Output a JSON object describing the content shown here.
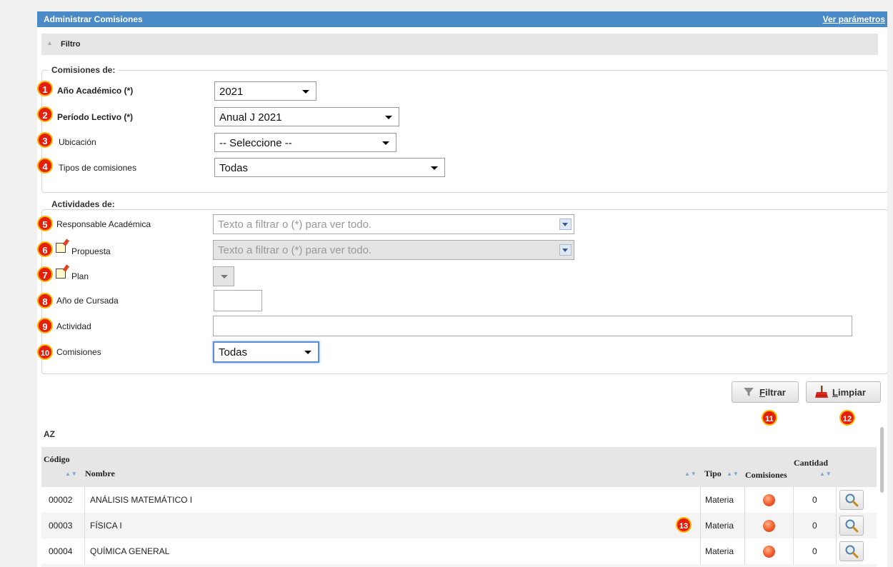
{
  "header": {
    "title": "Administrar Comisiones",
    "link": "Ver parámetros"
  },
  "filter": {
    "title": "Filtro"
  },
  "comisiones_group": {
    "legend": "Comisiones de:",
    "fields": [
      {
        "badge": "1",
        "label": "Año Académico (*)",
        "value": "2021"
      },
      {
        "badge": "2",
        "label": "Período Lectivo (*)",
        "value": "Anual J 2021"
      },
      {
        "badge": "3",
        "label": "Ubicación",
        "value": "-- Seleccione --"
      },
      {
        "badge": "4",
        "label": "Tipos de comisiones",
        "value": "Todas"
      }
    ]
  },
  "actividades_group": {
    "legend": "Actividades de:",
    "fields": [
      {
        "badge": "5",
        "label": "Responsable Académica",
        "placeholder": "Texto a filtrar o (*) para ver todo."
      },
      {
        "badge": "6",
        "label": "Propuesta",
        "placeholder": "Texto a filtrar o (*) para ver todo."
      },
      {
        "badge": "7",
        "label": "Plan"
      },
      {
        "badge": "8",
        "label": "Año de Cursada"
      },
      {
        "badge": "9",
        "label": "Actividad"
      },
      {
        "badge": "10",
        "label": "Comisiones",
        "value": "Todas"
      }
    ]
  },
  "buttons": {
    "filtrar": {
      "first": "F",
      "rest": "iltrar",
      "badge": "11"
    },
    "limpiar": {
      "first": "L",
      "rest": "impiar",
      "badge": "12"
    }
  },
  "sort_label": "AZ",
  "table": {
    "headers": {
      "codigo": "Código",
      "nombre": "Nombre",
      "tipo": "Tipo",
      "comisiones": "Comisiones",
      "cantidad": "Cantidad"
    },
    "rows": [
      {
        "codigo": "00002",
        "nombre": "ANÁLISIS MATEMÁTICO I",
        "tipo": "Materia",
        "cantidad": "0"
      },
      {
        "codigo": "00003",
        "nombre": "FÍSICA I",
        "tipo": "Materia",
        "cantidad": "0"
      },
      {
        "codigo": "00004",
        "nombre": "QUÍMICA GENERAL",
        "tipo": "Materia",
        "cantidad": "0"
      }
    ],
    "row_badge": "13"
  },
  "colors": {
    "accent": "#4a8bc7",
    "badge": "#e4200c",
    "status_dot": "#f05a2a"
  },
  "icons": [
    "filter-icon",
    "broom-icon",
    "magnifier-icon",
    "new-icon",
    "sort-az-icon"
  ]
}
